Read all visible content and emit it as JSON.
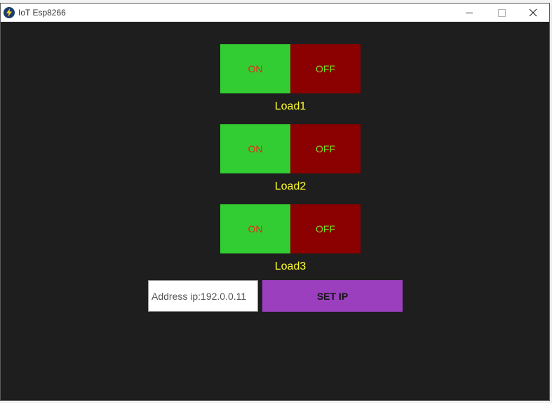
{
  "window": {
    "title": "IoT Esp8266",
    "icon": "lightning-icon"
  },
  "loads": [
    {
      "label": "Load1",
      "on_label": "ON",
      "off_label": "OFF"
    },
    {
      "label": "Load2",
      "on_label": "ON",
      "off_label": "OFF"
    },
    {
      "label": "Load3",
      "on_label": "ON",
      "off_label": "OFF"
    }
  ],
  "ip": {
    "value": "Address ip:192.0.0.11",
    "button_label": "SET IP"
  },
  "colors": {
    "background": "#1e1e1e",
    "on_button": "#32cd32",
    "on_text": "#e7291c",
    "off_button": "#8b0000",
    "off_text": "#7cdb1f",
    "label_text": "#ffff2e",
    "set_ip_button": "#9b3fbf"
  }
}
